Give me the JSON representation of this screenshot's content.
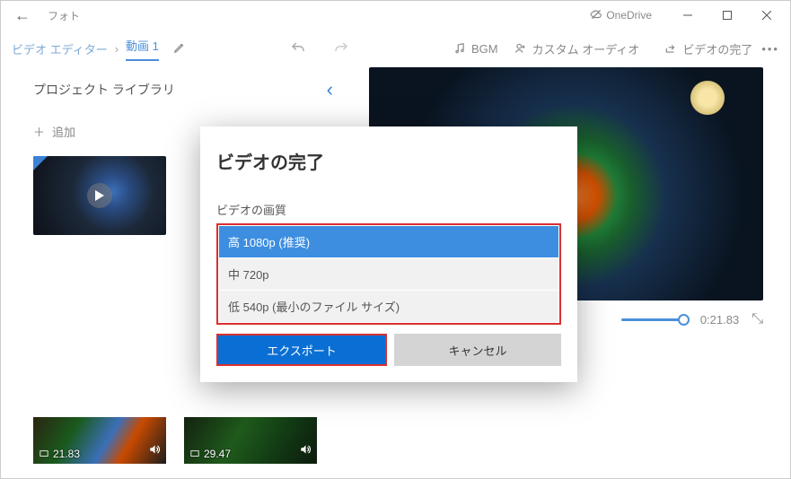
{
  "titlebar": {
    "app": "フォト",
    "onedrive": "OneDrive"
  },
  "toolbar": {
    "breadcrumb": "ビデオ エディター",
    "project": "動画 1",
    "bgm": "BGM",
    "custom_audio": "カスタム オーディオ",
    "finish": "ビデオの完了"
  },
  "sidebar": {
    "library_title": "プロジェクト ライブラリ",
    "add_label": "追加"
  },
  "preview": {
    "time": "0:21.83"
  },
  "clips": [
    {
      "duration": "21.83"
    },
    {
      "duration": "29.47"
    }
  ],
  "dialog": {
    "title": "ビデオの完了",
    "quality_label": "ビデオの画質",
    "options": {
      "high": "高 1080p (推奨)",
      "medium": "中 720p",
      "low": "低 540p (最小のファイル サイズ)"
    },
    "export": "エクスポート",
    "cancel": "キャンセル"
  }
}
